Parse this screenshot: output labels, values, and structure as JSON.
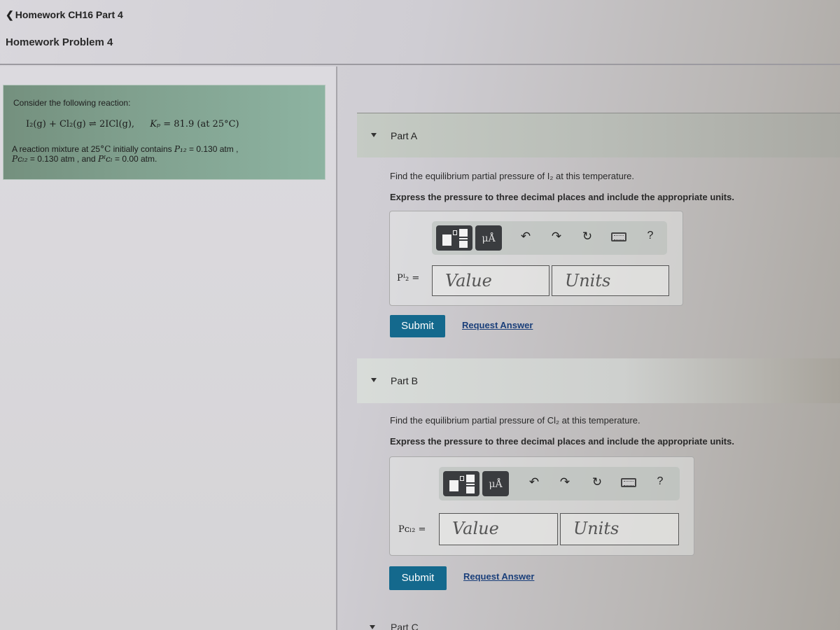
{
  "header": {
    "breadcrumb": "Homework CH16 Part 4",
    "back_icon": "chevron-left-icon",
    "title": "Homework Problem 4"
  },
  "problem": {
    "intro": "Consider the following reaction:",
    "equation": {
      "reactants": "I₂(g) + Cl₂(g)",
      "arrow": "⇌",
      "products": "2ICl(g),",
      "kp_label": "Kₚ",
      "kp_value": "= 81.9 (at 25°C)"
    },
    "conditions_line1_prefix": "A reaction mixture at 25",
    "conditions_degC": "°C",
    "conditions_line1_mid": " initially contains ",
    "p_i2_label": "P₁₂",
    "p_i2_value": " = 0.130 atm ,",
    "p_cl2_label": "Pᴄₗ₂",
    "p_cl2_value": " = 0.130 atm , and ",
    "p_icl_label": "Pᴵᴄₗ",
    "p_icl_value": " = 0.00 atm."
  },
  "parts": [
    {
      "label": "Part A",
      "question": "Find the equilibrium partial pressure of I₂ at this temperature.",
      "instruction": "Express the pressure to three decimal places and include the appropriate units.",
      "variable_label": "Pᴵ₂ =",
      "value_placeholder": "Value",
      "units_placeholder": "Units",
      "toolbar": {
        "templates_icon": "templates-icon",
        "units_label": "μÅ",
        "undo_icon": "↶",
        "redo_icon": "↷",
        "reset_icon": "↻",
        "keyboard_icon": "keyboard-icon",
        "help_label": "?"
      },
      "submit_label": "Submit",
      "request_label": "Request Answer"
    },
    {
      "label": "Part B",
      "question": "Find the equilibrium partial pressure of Cl₂ at this temperature.",
      "instruction": "Express the pressure to three decimal places and include the appropriate units.",
      "variable_label": "Pᴄₗ₂ =",
      "value_placeholder": "Value",
      "units_placeholder": "Units",
      "toolbar": {
        "templates_icon": "templates-icon",
        "units_label": "μÅ",
        "undo_icon": "↶",
        "redo_icon": "↷",
        "reset_icon": "↻",
        "keyboard_icon": "keyboard-icon",
        "help_label": "?"
      },
      "submit_label": "Submit",
      "request_label": "Request Answer"
    }
  ],
  "part_c_label": "Part C",
  "colors": {
    "submit_bg": "#14698d",
    "link": "#1a3f7a",
    "problem_box": "#80a08e"
  }
}
